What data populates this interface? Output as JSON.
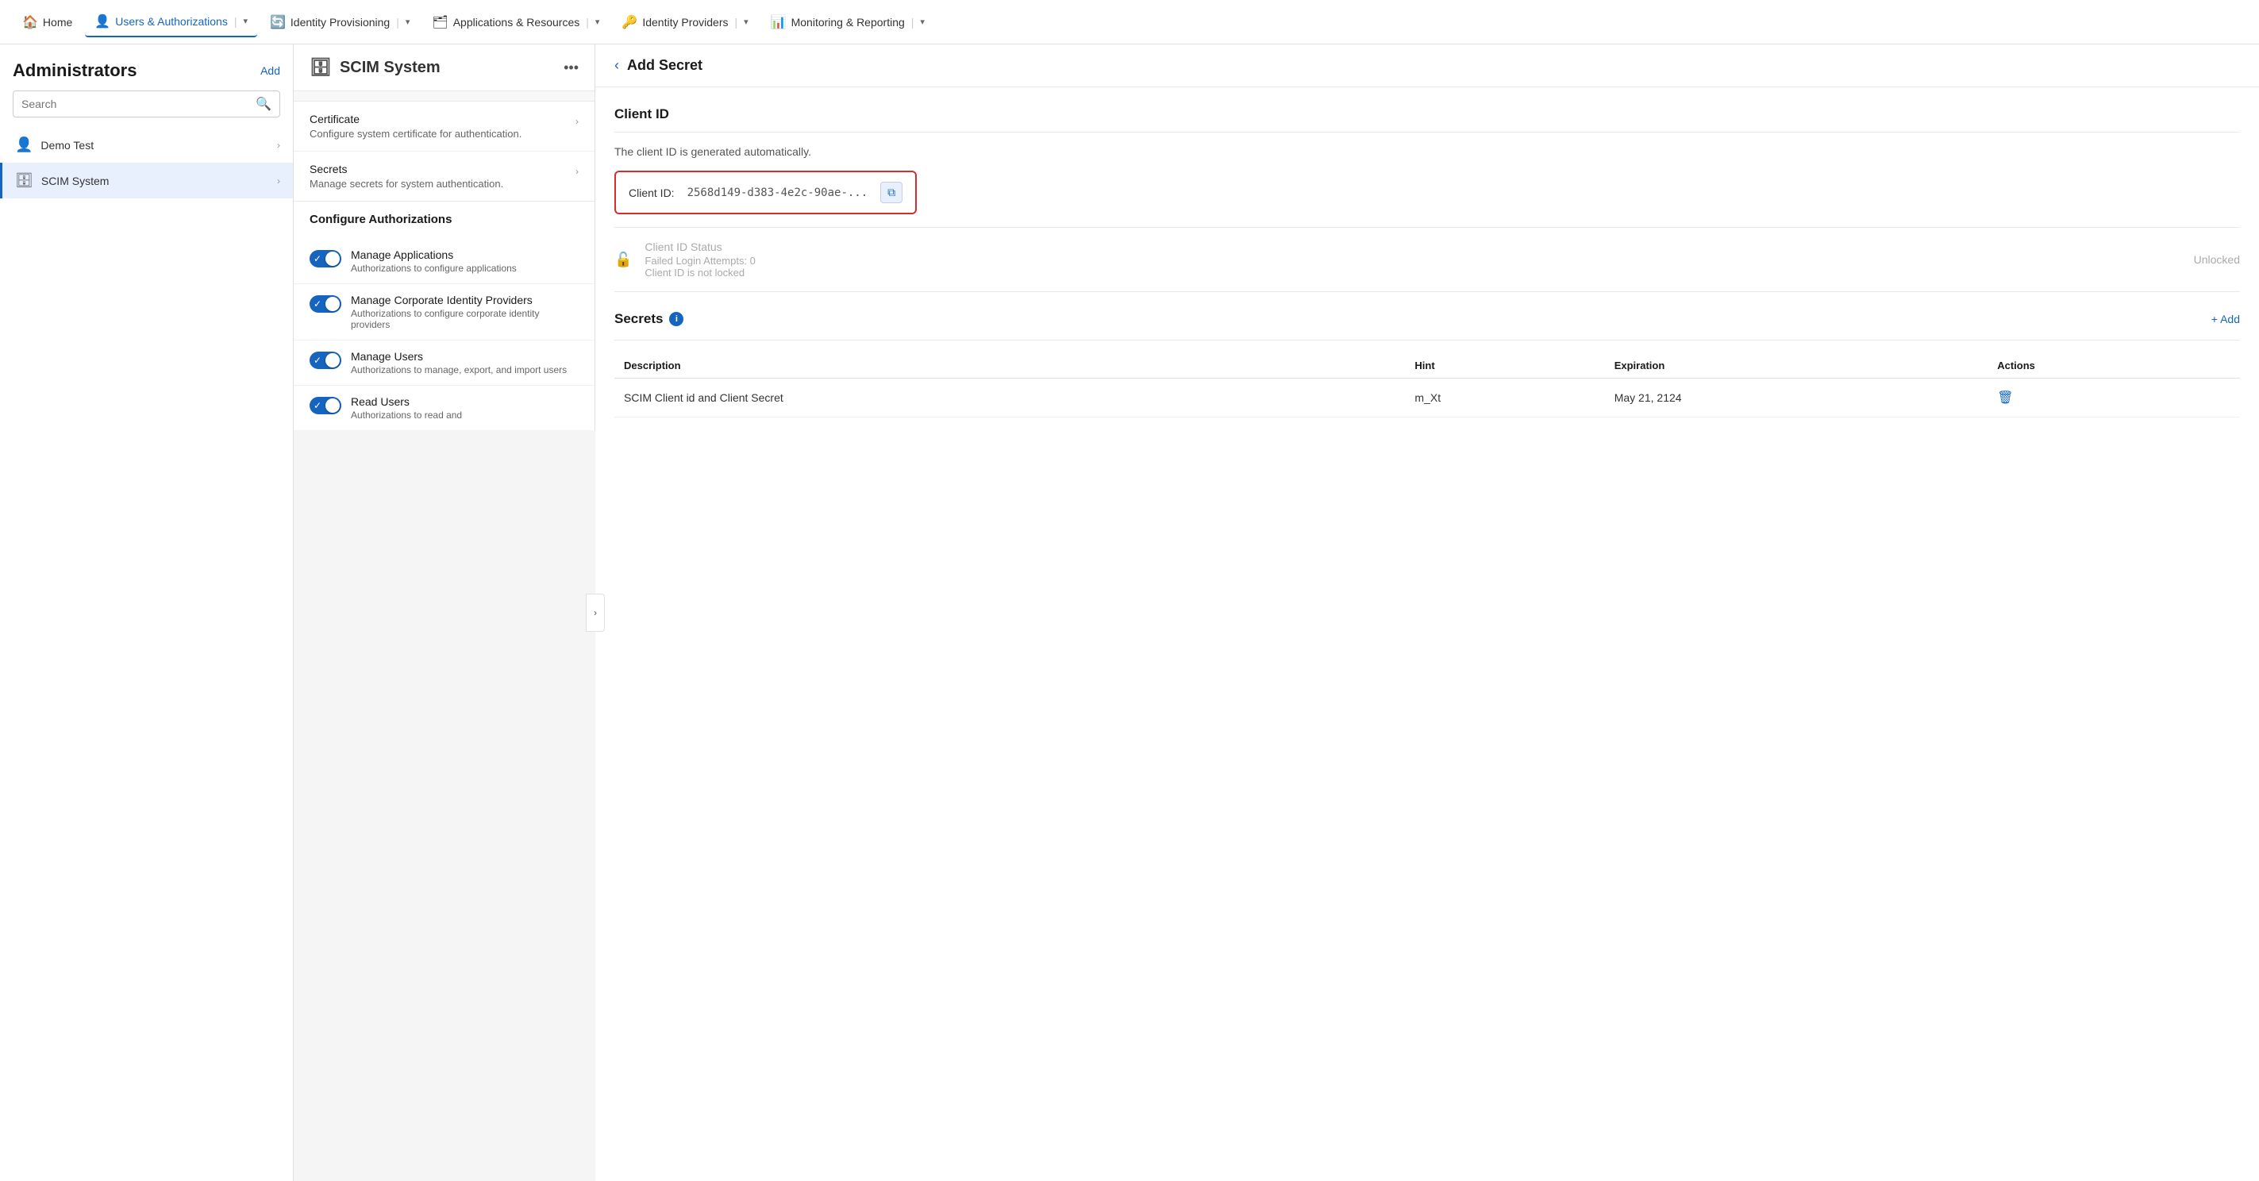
{
  "nav": {
    "items": [
      {
        "id": "home",
        "label": "Home",
        "icon": "🏠",
        "active": false
      },
      {
        "id": "users",
        "label": "Users & Authorizations",
        "icon": "👤",
        "active": true,
        "hasDropdown": true,
        "separator": true
      },
      {
        "id": "provisioning",
        "label": "Identity Provisioning",
        "icon": "🔄",
        "active": false,
        "hasDropdown": true,
        "separator": true
      },
      {
        "id": "applications",
        "label": "Applications & Resources",
        "icon": "🗂",
        "active": false,
        "hasDropdown": true,
        "separator": true
      },
      {
        "id": "identity",
        "label": "Identity Providers",
        "icon": "🔑",
        "active": false,
        "hasDropdown": true,
        "separator": true
      },
      {
        "id": "monitoring",
        "label": "Monitoring & Reporting",
        "icon": "📊",
        "active": false,
        "hasDropdown": true
      }
    ]
  },
  "sidebar": {
    "title": "Administrators",
    "add_label": "Add",
    "search_placeholder": "Search",
    "items": [
      {
        "id": "demo-test",
        "label": "Demo Test",
        "icon": "👤",
        "active": false
      },
      {
        "id": "scim-system",
        "label": "SCIM System",
        "icon": "🗄",
        "active": true
      }
    ]
  },
  "middle": {
    "title": "SCIM System",
    "icon": "🗄",
    "sections": [
      {
        "id": "certificate",
        "title": "Certificate",
        "desc": "Configure system certificate for authentication.",
        "hasArrow": true
      },
      {
        "id": "secrets",
        "title": "Secrets",
        "desc": "Manage secrets for system authentication.",
        "hasArrow": true
      }
    ],
    "configure_auth": {
      "title": "Configure Authorizations",
      "items": [
        {
          "id": "manage-apps",
          "title": "Manage Applications",
          "desc": "Authorizations to configure applications",
          "enabled": true
        },
        {
          "id": "manage-corp-idp",
          "title": "Manage Corporate Identity Providers",
          "desc": "Authorizations to configure corporate identity providers",
          "enabled": true
        },
        {
          "id": "manage-users",
          "title": "Manage Users",
          "desc": "Authorizations to manage, export, and import users",
          "enabled": true
        },
        {
          "id": "read-users",
          "title": "Read Users",
          "desc": "Authorizations to read and",
          "enabled": true
        }
      ]
    }
  },
  "right": {
    "back_label": "‹",
    "title": "Add Secret",
    "client_id": {
      "section_title": "Client ID",
      "note": "The client ID is generated automatically.",
      "label": "Client ID:",
      "value": "2568d149-d383-4e2c-90ae-...",
      "copy_icon": "⧉",
      "status": {
        "title": "Client ID Status",
        "failed_attempts": "Failed Login Attempts: 0",
        "locked_status": "Client ID is not locked",
        "badge": "Unlocked"
      }
    },
    "secrets": {
      "title": "Secrets",
      "add_label": "+ Add",
      "table": {
        "headers": [
          "Description",
          "Hint",
          "Expiration",
          "Actions"
        ],
        "rows": [
          {
            "description": "SCIM Client id and Client Secret",
            "hint": "m_Xt",
            "expiration": "May 21, 2124",
            "action": "delete"
          }
        ]
      }
    }
  }
}
